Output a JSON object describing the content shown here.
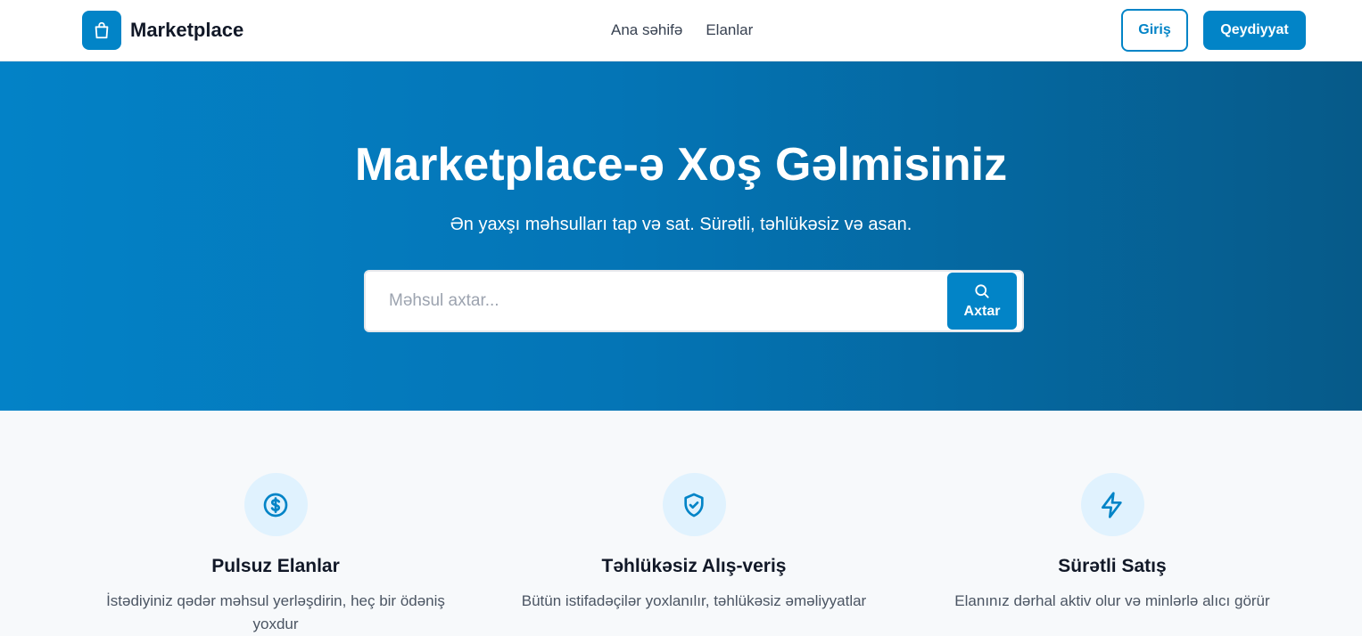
{
  "header": {
    "brand": "Marketplace",
    "nav": [
      "Ana səhifə",
      "Elanlar"
    ],
    "login_label": "Giriş",
    "register_label": "Qeydiyyat"
  },
  "hero": {
    "title": "Marketplace-ə Xoş Gəlmisiniz",
    "subtitle": "Ən yaxşı məhsulları tap və sat. Sürətli, təhlükəsiz və asan.",
    "search_placeholder": "Məhsul axtar...",
    "search_button": "Axtar"
  },
  "features": [
    {
      "icon": "dollar-icon",
      "title": "Pulsuz Elanlar",
      "desc": "İstədiyiniz qədər məhsul yerləşdirin, heç bir ödəniş yoxdur"
    },
    {
      "icon": "shield-check-icon",
      "title": "Təhlükəsiz Alış-veriş",
      "desc": "Bütün istifadəçilər yoxlanılır, təhlükəsiz əməliyyatlar"
    },
    {
      "icon": "lightning-icon",
      "title": "Sürətli Satış",
      "desc": "Elanınız dərhal aktiv olur və minlərlə alıcı görür"
    }
  ],
  "colors": {
    "accent": "#0284c7",
    "icon_bg": "#e0f2fe"
  }
}
